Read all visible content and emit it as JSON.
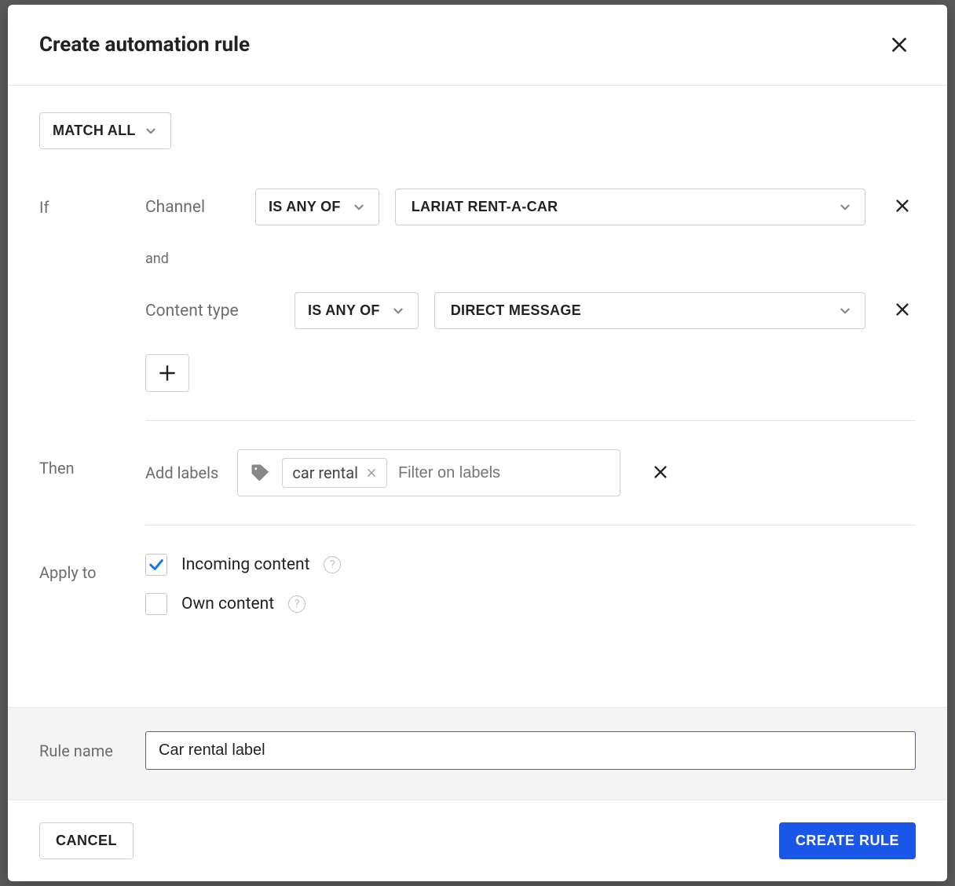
{
  "header": {
    "title": "Create automation rule"
  },
  "match": {
    "mode_label": "MATCH ALL"
  },
  "if": {
    "label": "If",
    "and_label": "and",
    "conditions": [
      {
        "field": "Channel",
        "operator": "IS ANY OF",
        "value": "LARIAT RENT-A-CAR"
      },
      {
        "field": "Content type",
        "operator": "IS ANY OF",
        "value": "DIRECT MESSAGE"
      }
    ]
  },
  "then": {
    "label": "Then",
    "action_label": "Add labels",
    "chips": [
      "car rental"
    ],
    "placeholder": "Filter on labels"
  },
  "apply": {
    "label": "Apply to",
    "options": [
      {
        "text": "Incoming content",
        "checked": true
      },
      {
        "text": "Own content",
        "checked": false
      }
    ]
  },
  "name": {
    "label": "Rule name",
    "value": "Car rental label"
  },
  "footer": {
    "cancel": "CANCEL",
    "submit": "CREATE RULE"
  }
}
